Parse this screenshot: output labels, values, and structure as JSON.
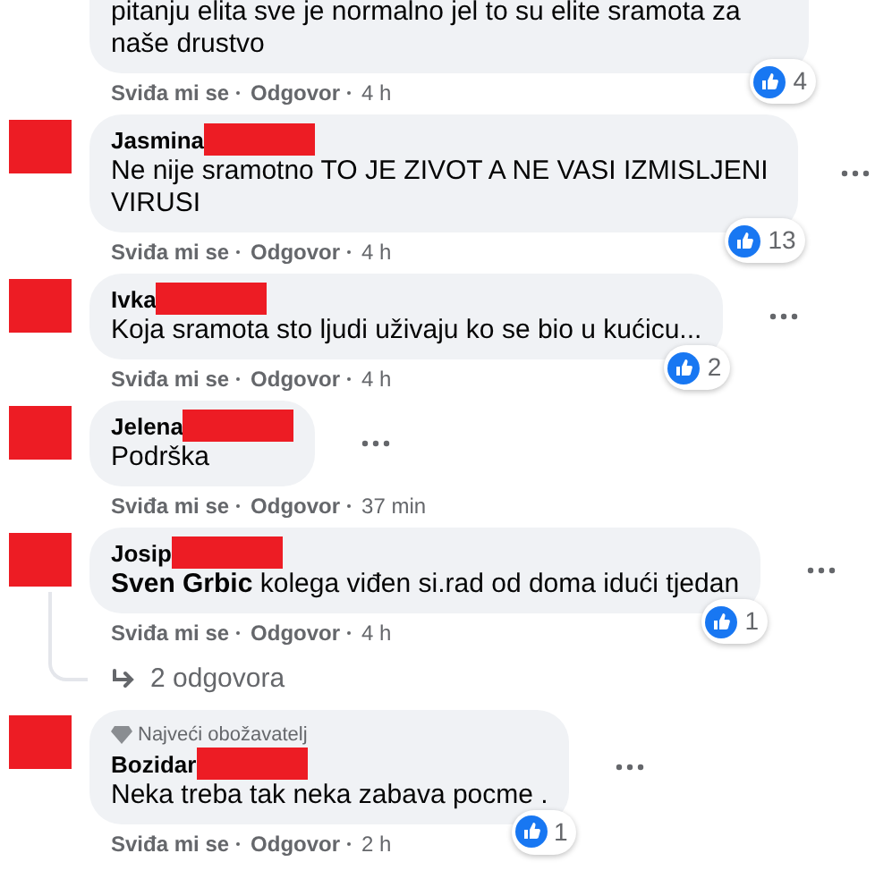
{
  "comments": [
    {
      "kind": "partial",
      "text": "pitanju elita sve je normalno jel to su elite sramota za naše drustvo",
      "reactions": "4",
      "like": "Sviđa mi se",
      "reply": "Odgovor",
      "time": "4 h",
      "menu": false
    },
    {
      "kind": "comment",
      "name": "Jasmina",
      "redacted": true,
      "text": "Ne nije sramotno TO JE ZIVOT A NE VASI IZMISLJENI VIRUSI",
      "reactions": "13",
      "like": "Sviđa mi se",
      "reply": "Odgovor",
      "time": "4 h",
      "menu": true
    },
    {
      "kind": "comment",
      "name": "Ivka",
      "redacted": true,
      "text": "Koja sramota sto ljudi uživaju ko se bio u kućicu...",
      "reactions": "2",
      "like": "Sviđa mi se",
      "reply": "Odgovor",
      "time": "4 h",
      "menu": true
    },
    {
      "kind": "comment",
      "name": "Jelena",
      "redacted": true,
      "text": "Podrška",
      "like": "Sviđa mi se",
      "reply": "Odgovor",
      "time": "37 min",
      "menu": true
    },
    {
      "kind": "comment",
      "name": "Josip",
      "redacted": true,
      "text": "**Sven Grbic** kolega viđen si.rad od doma idući tjedan",
      "reactions": "1",
      "like": "Sviđa mi se",
      "reply": "Odgovor",
      "time": "4 h",
      "menu": true,
      "replies": "2 odgovora"
    },
    {
      "kind": "comment",
      "badge": "Najveći obožavatelj",
      "name": "Bozidar",
      "redacted": true,
      "text": "Neka treba tak neka zabava pocme .",
      "reactions": "1",
      "like": "Sviđa mi se",
      "reply": "Odgovor",
      "time": "2 h",
      "menu": true
    }
  ]
}
